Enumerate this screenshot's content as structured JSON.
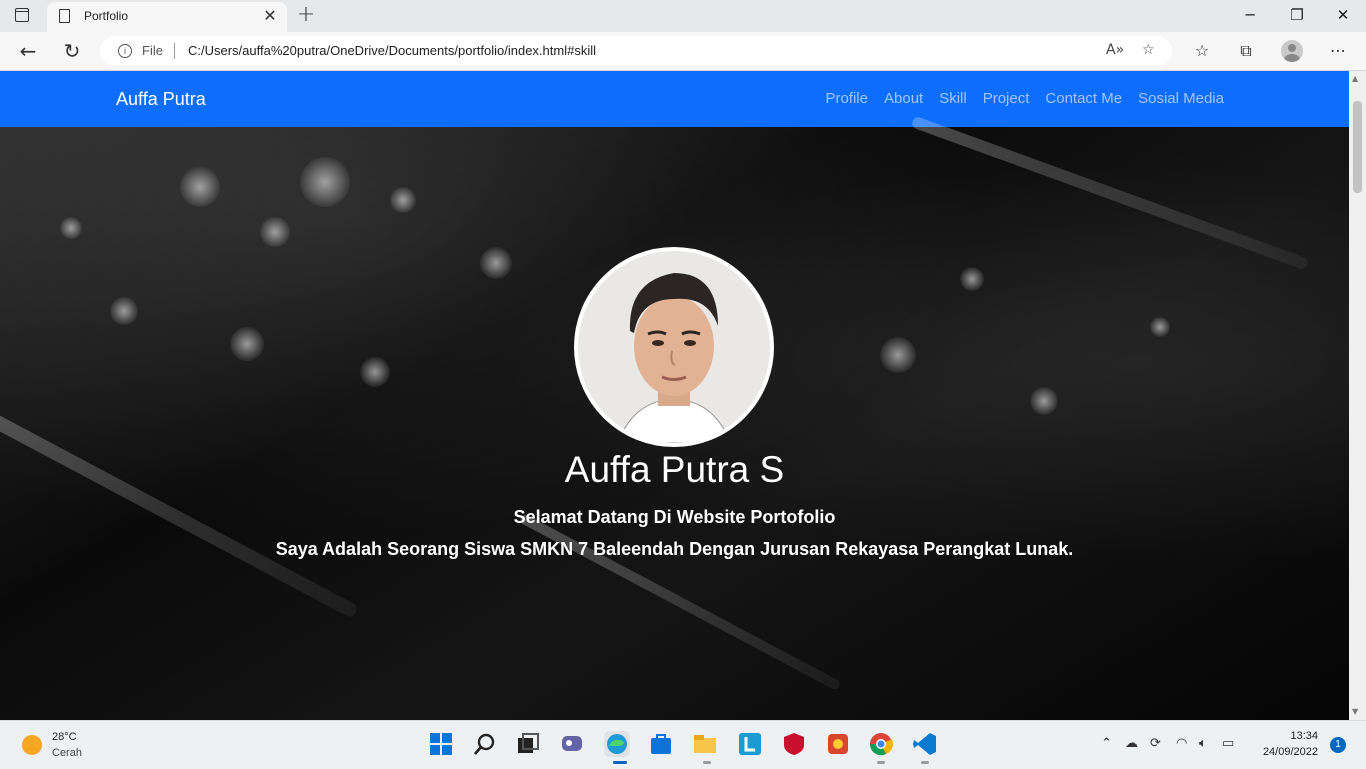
{
  "browser": {
    "tab_title": "Portfolio",
    "address_prefix": "File",
    "url": "C:/Users/auffa%20putra/OneDrive/Documents/portfolio/index.html#skill"
  },
  "page": {
    "brand": "Auffa Putra",
    "nav_links": [
      "Profile",
      "About",
      "Skill",
      "Project",
      "Contact Me",
      "Sosial Media"
    ],
    "hero": {
      "name": "Auffa Putra S",
      "line1": "Selamat Datang Di Website Portofolio",
      "line2": "Saya Adalah Seorang Siswa SMKN 7 Baleendah Dengan Jurusan Rekayasa Perangkat Lunak."
    },
    "colors": {
      "navbar": "#0d6efd",
      "text": "#ffffff"
    }
  },
  "taskbar": {
    "weather_temp": "28°C",
    "weather_condition": "Cerah",
    "time": "13:34",
    "date": "24/09/2022",
    "notification_count": "1",
    "apps": [
      "start-icon",
      "search-icon",
      "task-view-icon",
      "chat-icon",
      "edge-icon",
      "store-icon",
      "file-explorer-icon",
      "l-app-icon",
      "mcafee-icon",
      "game-icon",
      "chrome-icon",
      "vscode-icon"
    ]
  }
}
